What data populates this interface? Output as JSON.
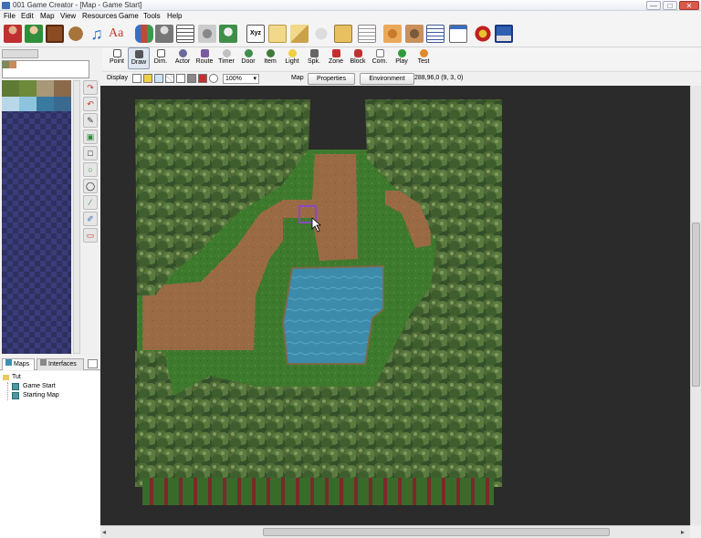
{
  "window": {
    "title": "001 Game Creator - [Map - Game Start]",
    "minimize": "—",
    "maximize": "□",
    "close": "✕"
  },
  "menu": [
    "File",
    "Edit",
    "Map",
    "View",
    "Resources",
    "Game",
    "Tools",
    "Help"
  ],
  "toolbar2": [
    "Point",
    "Draw",
    "Dim.",
    "Actor",
    "Route",
    "Timer",
    "Door",
    "Item",
    "Light",
    "Spk.",
    "Zone",
    "Block",
    "Com.",
    "Play",
    "Test"
  ],
  "display": {
    "label": "Display",
    "zoom": "100%",
    "map_label": "Map",
    "properties": "Properties",
    "environment": "Environment",
    "coords": "288,96,0 (9, 3, 0)"
  },
  "panel": {
    "tabs": [
      "Maps",
      "Interfaces"
    ],
    "tree": {
      "root": "Tut",
      "children": [
        "Game Start",
        "Starting Map"
      ]
    }
  },
  "toolbar1_icons": [
    "hero-icon",
    "character-icon",
    "door-icon",
    "bag-icon",
    "music-icon",
    "font-icon",
    "group-icon",
    "person-icon",
    "table-icon",
    "gear-icon",
    "robot-icon",
    "xyz-icon",
    "scroll-icon",
    "wand-icon",
    "controller-icon",
    "chest-icon",
    "notes-icon",
    "gear-icon",
    "gear-icon",
    "list-icon",
    "window-icon",
    "ball-icon",
    "save-icon"
  ],
  "colors": {
    "accent": "#3f6fb5",
    "grass": "#3e7a2d",
    "dirt": "#9a6a45",
    "water": "#3c8bab",
    "forest": "#2e4a22"
  }
}
